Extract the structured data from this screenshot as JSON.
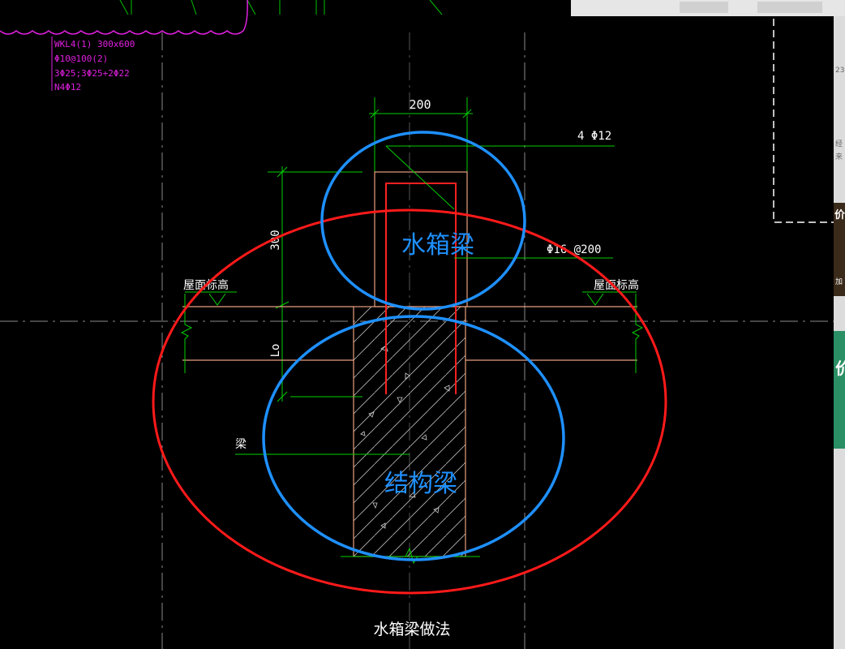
{
  "drawing": {
    "title": "水箱梁做法",
    "beam_tag": [
      "WKL4(1) 300x600",
      "Φ10@100(2)",
      "3Φ25;3Φ25+2Φ22",
      "N4Φ12"
    ],
    "dim_width": "200",
    "dim_height": "300",
    "dim_lo": "Lo",
    "rebar_top": "4 Φ12",
    "rebar_stirrup": "Φ16 @200",
    "roof_elev_left": "屋面标高",
    "roof_elev_right": "屋面标高",
    "beam_label": "梁"
  },
  "annotations": {
    "tank_beam": "水箱梁",
    "structural_beam": "结构梁"
  },
  "panel": {
    "text_1": "23",
    "text_2": "经",
    "text_3": "来",
    "text_4": "价",
    "text_5": "加",
    "text_6": "价"
  },
  "colors": {
    "background": "#000000",
    "annotation_blue": "#1e90ff",
    "outline_red": "#ff1a1a",
    "dim_green": "#00d000",
    "tag_magenta": "#e020e0",
    "beam_outline": "#e8a080"
  }
}
